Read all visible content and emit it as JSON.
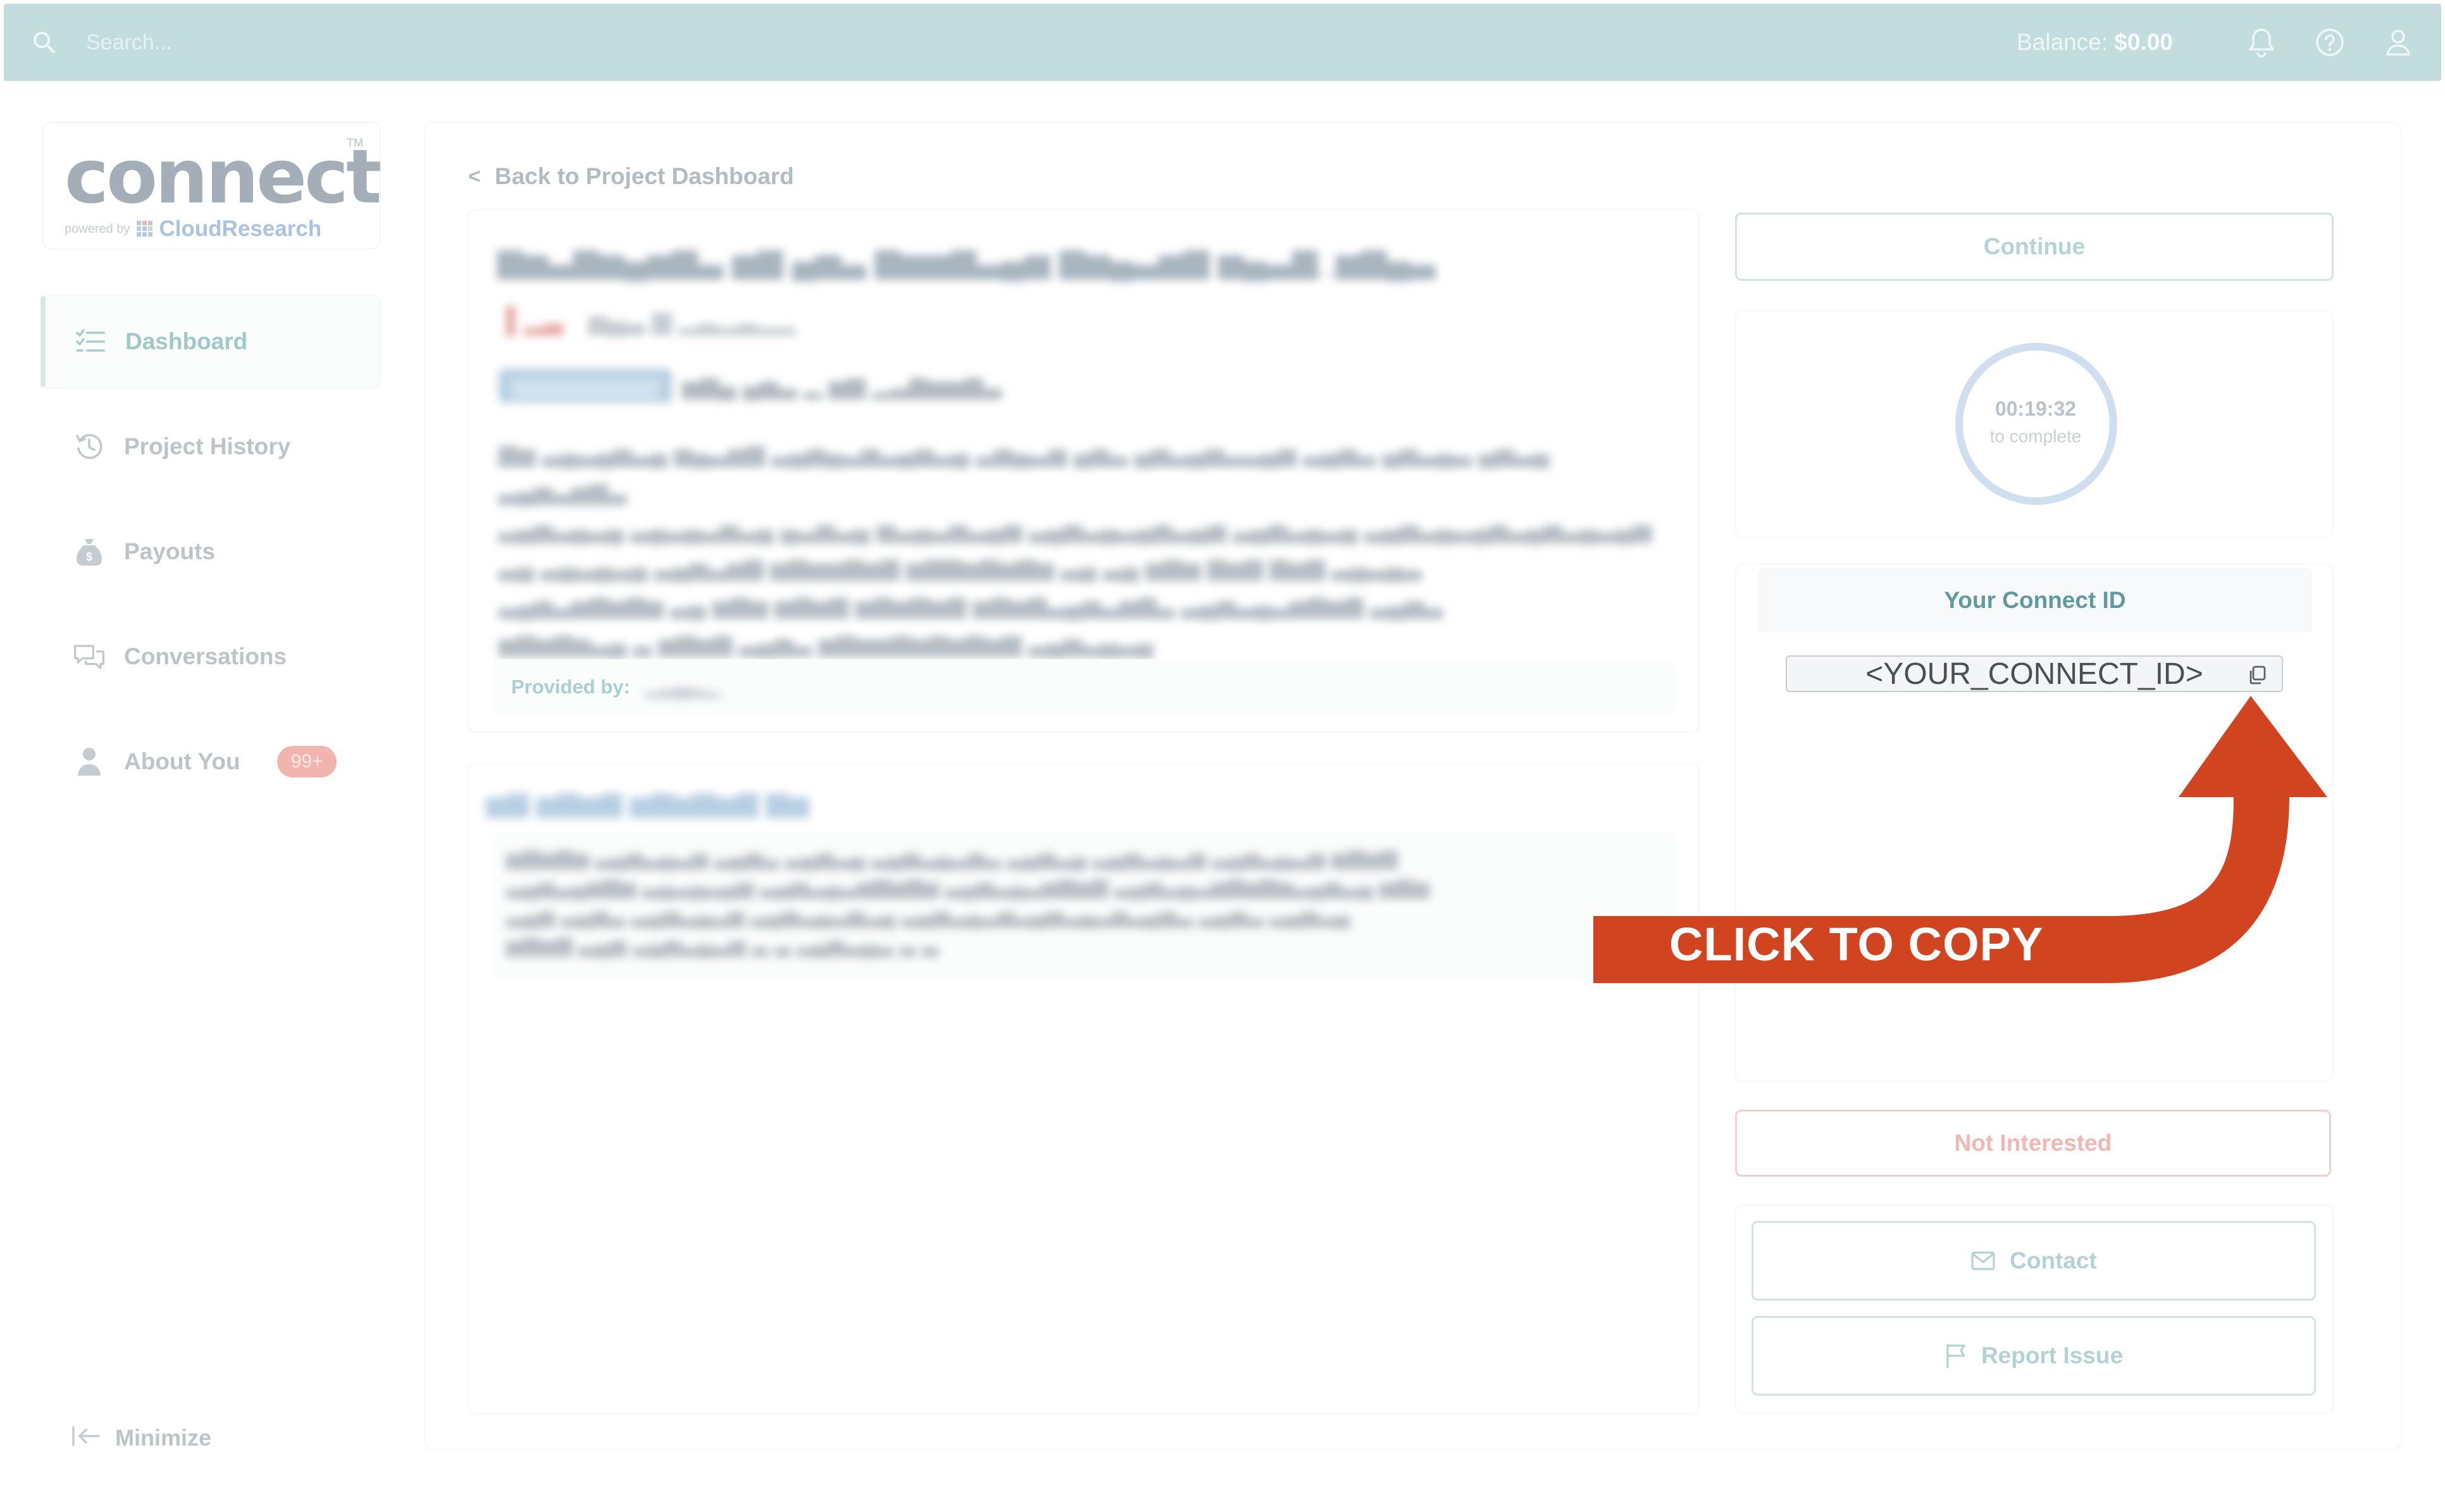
{
  "topbar": {
    "search_placeholder": "Search...",
    "balance_label": "Balance: ",
    "balance_value": "$0.00",
    "icons": [
      "search-icon",
      "bell-icon",
      "help-icon",
      "user-icon"
    ]
  },
  "logo": {
    "wordmark": "connect",
    "tm": "TM",
    "powered_by": "powered by",
    "brand": "CloudResearch"
  },
  "sidebar": {
    "items": [
      {
        "label": "Dashboard",
        "icon": "list-icon",
        "active": true
      },
      {
        "label": "Project History",
        "icon": "history-icon"
      },
      {
        "label": "Payouts",
        "icon": "money-bag-icon"
      },
      {
        "label": "Conversations",
        "icon": "chat-icon"
      },
      {
        "label": "About You",
        "icon": "person-icon",
        "badge": "99+"
      }
    ],
    "minimize_label": "Minimize"
  },
  "main": {
    "back_label": "Back to Project Dashboard",
    "provided_by_label": "Provided by:"
  },
  "right": {
    "continue_label": "Continue",
    "timer_value": "00:19:32",
    "timer_sub": "to complete",
    "connect_id_title": "Your Connect ID",
    "connect_id_value": "<YOUR_CONNECT_ID>",
    "not_interested_label": "Not Interested",
    "contact_label": "Contact",
    "report_label": "Report Issue"
  },
  "annotation": {
    "label": "CLICK TO COPY",
    "color": "#d0441f"
  },
  "colors": {
    "accent": "#5e9aa0",
    "topbar_bg": "#c3dcdd",
    "badge": "#f1b5ad",
    "danger_outline": "#f3cfcc"
  }
}
